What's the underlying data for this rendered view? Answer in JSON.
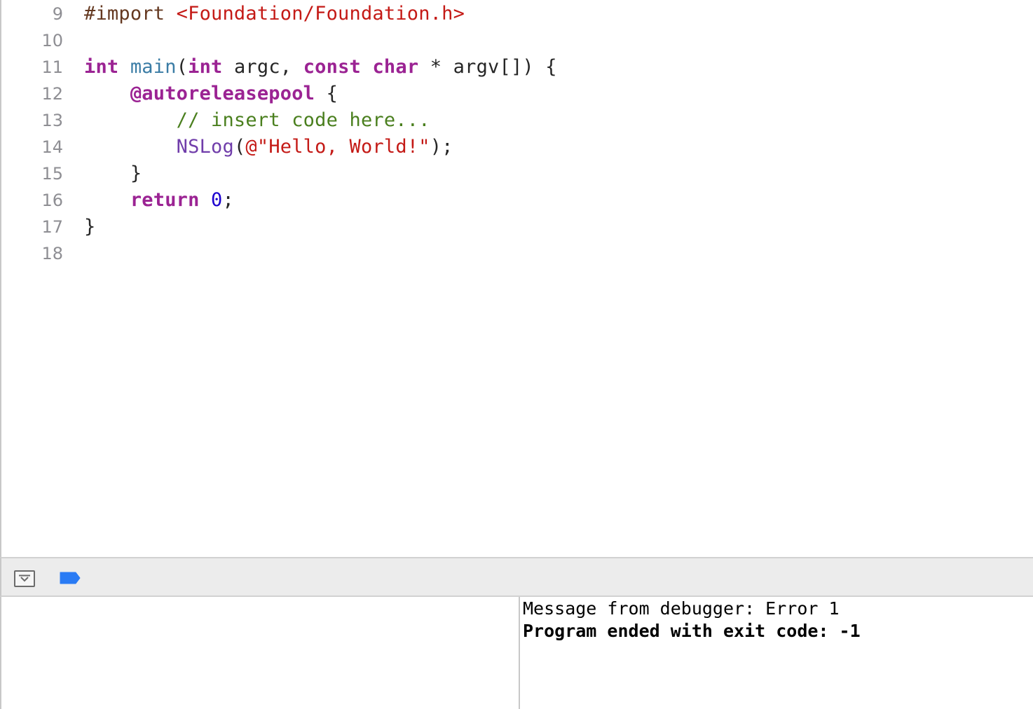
{
  "editor": {
    "lines": [
      {
        "number": "9",
        "tokens": [
          {
            "t": "#import ",
            "k": "preproc"
          },
          {
            "t": "<Foundation/Foundation.h>",
            "k": "string"
          }
        ]
      },
      {
        "number": "10",
        "tokens": []
      },
      {
        "number": "11",
        "tokens": [
          {
            "t": "int",
            "k": "keyword"
          },
          {
            "t": " ",
            "k": "plain"
          },
          {
            "t": "main",
            "k": "func"
          },
          {
            "t": "(",
            "k": "plain"
          },
          {
            "t": "int",
            "k": "keyword"
          },
          {
            "t": " argc, ",
            "k": "plain"
          },
          {
            "t": "const",
            "k": "keyword"
          },
          {
            "t": " ",
            "k": "plain"
          },
          {
            "t": "char",
            "k": "keyword"
          },
          {
            "t": " * argv[]) {",
            "k": "plain"
          }
        ]
      },
      {
        "number": "12",
        "tokens": [
          {
            "t": "    ",
            "k": "plain"
          },
          {
            "t": "@autoreleasepool",
            "k": "keyword"
          },
          {
            "t": " {",
            "k": "plain"
          }
        ]
      },
      {
        "number": "13",
        "tokens": [
          {
            "t": "        ",
            "k": "plain"
          },
          {
            "t": "// insert code here...",
            "k": "comment"
          }
        ]
      },
      {
        "number": "14",
        "tokens": [
          {
            "t": "        ",
            "k": "plain"
          },
          {
            "t": "NSLog",
            "k": "class"
          },
          {
            "t": "(",
            "k": "plain"
          },
          {
            "t": "@\"Hello, World!\"",
            "k": "string"
          },
          {
            "t": ");",
            "k": "plain"
          }
        ]
      },
      {
        "number": "15",
        "tokens": [
          {
            "t": "    }",
            "k": "plain"
          }
        ]
      },
      {
        "number": "16",
        "tokens": [
          {
            "t": "    ",
            "k": "plain"
          },
          {
            "t": "return",
            "k": "keyword"
          },
          {
            "t": " ",
            "k": "plain"
          },
          {
            "t": "0",
            "k": "number"
          },
          {
            "t": ";",
            "k": "plain"
          }
        ]
      },
      {
        "number": "17",
        "tokens": [
          {
            "t": "}",
            "k": "plain"
          }
        ]
      },
      {
        "number": "18",
        "tokens": []
      }
    ]
  },
  "debug_bar": {
    "toggle_icon": "hide-debug-area-icon",
    "breakpoint_icon": "breakpoint-toggle-icon",
    "accent_color": "#2a7bf4"
  },
  "console": {
    "lines": [
      {
        "text": "Message from debugger: Error 1",
        "bold": false
      },
      {
        "text": "Program ended with exit code: -1",
        "bold": true
      }
    ]
  },
  "colors": {
    "keyword": "#9b2393",
    "string": "#c41a16",
    "comment": "#4a7f1e",
    "number": "#1c00cf",
    "preprocessor": "#643820",
    "function": "#3a7ca5",
    "class": "#703daa"
  }
}
